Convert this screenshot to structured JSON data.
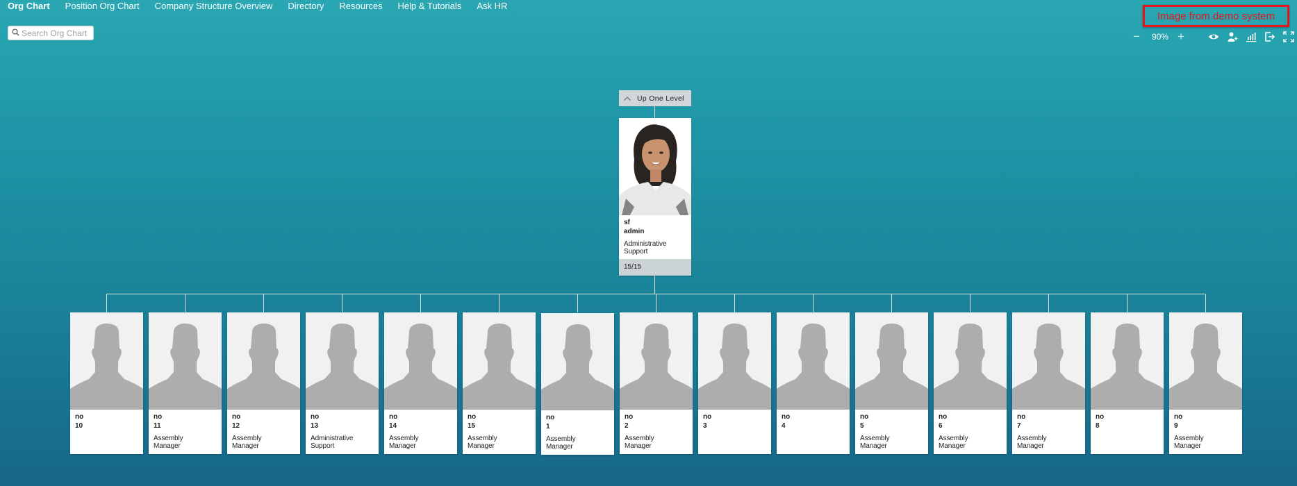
{
  "nav": {
    "items": [
      {
        "label": "Org Chart",
        "active": true
      },
      {
        "label": "Position Org Chart",
        "active": false
      },
      {
        "label": "Company Structure Overview",
        "active": false
      },
      {
        "label": "Directory",
        "active": false
      },
      {
        "label": "Resources",
        "active": false
      },
      {
        "label": "Help & Tutorials",
        "active": false
      },
      {
        "label": "Ask HR",
        "active": false
      }
    ]
  },
  "search": {
    "placeholder": "Search Org Chart",
    "value": "",
    "icon": "search-icon"
  },
  "banner": {
    "text": "Image from demo system",
    "color": "#e8141c"
  },
  "toolbar": {
    "zoom_out_icon": "minus-icon",
    "zoom_level": "90%",
    "zoom_in_icon": "plus-icon",
    "icons": [
      "eye-icon",
      "add-user-icon",
      "bar-chart-icon",
      "export-icon",
      "fullscreen-icon"
    ],
    "zoom_minus_glyph": "−",
    "zoom_plus_glyph": "+"
  },
  "up_level": {
    "label": "Up One Level",
    "icon": "chevron-up-icon"
  },
  "root": {
    "first_name": "sf",
    "last_name": "admin",
    "title": "Administrative Support",
    "direct_reports": "15/15",
    "photo": "employee-photo"
  },
  "children": [
    {
      "first_name": "no",
      "last_name": "10",
      "title": ""
    },
    {
      "first_name": "no",
      "last_name": "11",
      "title": "Assembly Manager"
    },
    {
      "first_name": "no",
      "last_name": "12",
      "title": "Assembly Manager"
    },
    {
      "first_name": "no",
      "last_name": "13",
      "title": "Administrative Support"
    },
    {
      "first_name": "no",
      "last_name": "14",
      "title": "Assembly Manager"
    },
    {
      "first_name": "no",
      "last_name": "15",
      "title": "Assembly Manager"
    },
    {
      "first_name": "no",
      "last_name": "1",
      "title": "Assembly Manager"
    },
    {
      "first_name": "no",
      "last_name": "2",
      "title": "Assembly Manager"
    },
    {
      "first_name": "no",
      "last_name": "3",
      "title": ""
    },
    {
      "first_name": "no",
      "last_name": "4",
      "title": ""
    },
    {
      "first_name": "no",
      "last_name": "5",
      "title": "Assembly Manager"
    },
    {
      "first_name": "no",
      "last_name": "6",
      "title": "Assembly Manager"
    },
    {
      "first_name": "no",
      "last_name": "7",
      "title": "Assembly Manager"
    },
    {
      "first_name": "no",
      "last_name": "8",
      "title": ""
    },
    {
      "first_name": "no",
      "last_name": "9",
      "title": "Assembly Manager"
    }
  ],
  "colors": {
    "background_top": "#2aa7b2",
    "background_bottom": "#17668a",
    "connector": "#d9e4e6",
    "placeholder_silhouette": "#adadad"
  }
}
